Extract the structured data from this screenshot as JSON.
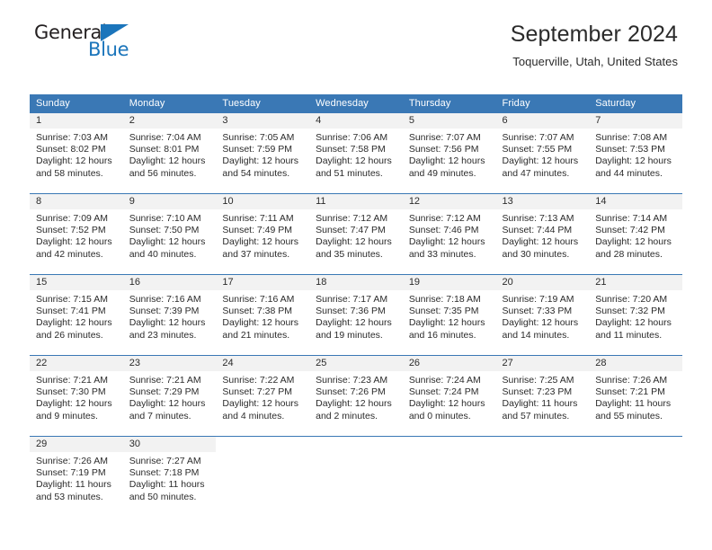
{
  "logo": {
    "word1": "General",
    "word2": "Blue",
    "triangle_color": "#1b75bb"
  },
  "header": {
    "title": "September 2024",
    "subtitle": "Toquerville, Utah, United States"
  },
  "calendar": {
    "header_color": "#3a78b5",
    "daynum_band_color": "#f2f2f2",
    "weekday_headers": [
      "Sunday",
      "Monday",
      "Tuesday",
      "Wednesday",
      "Thursday",
      "Friday",
      "Saturday"
    ],
    "weeks": [
      [
        {
          "day": "1",
          "sunrise": "Sunrise: 7:03 AM",
          "sunset": "Sunset: 8:02 PM",
          "daylight": "Daylight: 12 hours and 58 minutes."
        },
        {
          "day": "2",
          "sunrise": "Sunrise: 7:04 AM",
          "sunset": "Sunset: 8:01 PM",
          "daylight": "Daylight: 12 hours and 56 minutes."
        },
        {
          "day": "3",
          "sunrise": "Sunrise: 7:05 AM",
          "sunset": "Sunset: 7:59 PM",
          "daylight": "Daylight: 12 hours and 54 minutes."
        },
        {
          "day": "4",
          "sunrise": "Sunrise: 7:06 AM",
          "sunset": "Sunset: 7:58 PM",
          "daylight": "Daylight: 12 hours and 51 minutes."
        },
        {
          "day": "5",
          "sunrise": "Sunrise: 7:07 AM",
          "sunset": "Sunset: 7:56 PM",
          "daylight": "Daylight: 12 hours and 49 minutes."
        },
        {
          "day": "6",
          "sunrise": "Sunrise: 7:07 AM",
          "sunset": "Sunset: 7:55 PM",
          "daylight": "Daylight: 12 hours and 47 minutes."
        },
        {
          "day": "7",
          "sunrise": "Sunrise: 7:08 AM",
          "sunset": "Sunset: 7:53 PM",
          "daylight": "Daylight: 12 hours and 44 minutes."
        }
      ],
      [
        {
          "day": "8",
          "sunrise": "Sunrise: 7:09 AM",
          "sunset": "Sunset: 7:52 PM",
          "daylight": "Daylight: 12 hours and 42 minutes."
        },
        {
          "day": "9",
          "sunrise": "Sunrise: 7:10 AM",
          "sunset": "Sunset: 7:50 PM",
          "daylight": "Daylight: 12 hours and 40 minutes."
        },
        {
          "day": "10",
          "sunrise": "Sunrise: 7:11 AM",
          "sunset": "Sunset: 7:49 PM",
          "daylight": "Daylight: 12 hours and 37 minutes."
        },
        {
          "day": "11",
          "sunrise": "Sunrise: 7:12 AM",
          "sunset": "Sunset: 7:47 PM",
          "daylight": "Daylight: 12 hours and 35 minutes."
        },
        {
          "day": "12",
          "sunrise": "Sunrise: 7:12 AM",
          "sunset": "Sunset: 7:46 PM",
          "daylight": "Daylight: 12 hours and 33 minutes."
        },
        {
          "day": "13",
          "sunrise": "Sunrise: 7:13 AM",
          "sunset": "Sunset: 7:44 PM",
          "daylight": "Daylight: 12 hours and 30 minutes."
        },
        {
          "day": "14",
          "sunrise": "Sunrise: 7:14 AM",
          "sunset": "Sunset: 7:42 PM",
          "daylight": "Daylight: 12 hours and 28 minutes."
        }
      ],
      [
        {
          "day": "15",
          "sunrise": "Sunrise: 7:15 AM",
          "sunset": "Sunset: 7:41 PM",
          "daylight": "Daylight: 12 hours and 26 minutes."
        },
        {
          "day": "16",
          "sunrise": "Sunrise: 7:16 AM",
          "sunset": "Sunset: 7:39 PM",
          "daylight": "Daylight: 12 hours and 23 minutes."
        },
        {
          "day": "17",
          "sunrise": "Sunrise: 7:16 AM",
          "sunset": "Sunset: 7:38 PM",
          "daylight": "Daylight: 12 hours and 21 minutes."
        },
        {
          "day": "18",
          "sunrise": "Sunrise: 7:17 AM",
          "sunset": "Sunset: 7:36 PM",
          "daylight": "Daylight: 12 hours and 19 minutes."
        },
        {
          "day": "19",
          "sunrise": "Sunrise: 7:18 AM",
          "sunset": "Sunset: 7:35 PM",
          "daylight": "Daylight: 12 hours and 16 minutes."
        },
        {
          "day": "20",
          "sunrise": "Sunrise: 7:19 AM",
          "sunset": "Sunset: 7:33 PM",
          "daylight": "Daylight: 12 hours and 14 minutes."
        },
        {
          "day": "21",
          "sunrise": "Sunrise: 7:20 AM",
          "sunset": "Sunset: 7:32 PM",
          "daylight": "Daylight: 12 hours and 11 minutes."
        }
      ],
      [
        {
          "day": "22",
          "sunrise": "Sunrise: 7:21 AM",
          "sunset": "Sunset: 7:30 PM",
          "daylight": "Daylight: 12 hours and 9 minutes."
        },
        {
          "day": "23",
          "sunrise": "Sunrise: 7:21 AM",
          "sunset": "Sunset: 7:29 PM",
          "daylight": "Daylight: 12 hours and 7 minutes."
        },
        {
          "day": "24",
          "sunrise": "Sunrise: 7:22 AM",
          "sunset": "Sunset: 7:27 PM",
          "daylight": "Daylight: 12 hours and 4 minutes."
        },
        {
          "day": "25",
          "sunrise": "Sunrise: 7:23 AM",
          "sunset": "Sunset: 7:26 PM",
          "daylight": "Daylight: 12 hours and 2 minutes."
        },
        {
          "day": "26",
          "sunrise": "Sunrise: 7:24 AM",
          "sunset": "Sunset: 7:24 PM",
          "daylight": "Daylight: 12 hours and 0 minutes."
        },
        {
          "day": "27",
          "sunrise": "Sunrise: 7:25 AM",
          "sunset": "Sunset: 7:23 PM",
          "daylight": "Daylight: 11 hours and 57 minutes."
        },
        {
          "day": "28",
          "sunrise": "Sunrise: 7:26 AM",
          "sunset": "Sunset: 7:21 PM",
          "daylight": "Daylight: 11 hours and 55 minutes."
        }
      ],
      [
        {
          "day": "29",
          "sunrise": "Sunrise: 7:26 AM",
          "sunset": "Sunset: 7:19 PM",
          "daylight": "Daylight: 11 hours and 53 minutes."
        },
        {
          "day": "30",
          "sunrise": "Sunrise: 7:27 AM",
          "sunset": "Sunset: 7:18 PM",
          "daylight": "Daylight: 11 hours and 50 minutes."
        },
        {
          "day": "",
          "sunrise": "",
          "sunset": "",
          "daylight": ""
        },
        {
          "day": "",
          "sunrise": "",
          "sunset": "",
          "daylight": ""
        },
        {
          "day": "",
          "sunrise": "",
          "sunset": "",
          "daylight": ""
        },
        {
          "day": "",
          "sunrise": "",
          "sunset": "",
          "daylight": ""
        },
        {
          "day": "",
          "sunrise": "",
          "sunset": "",
          "daylight": ""
        }
      ]
    ]
  }
}
